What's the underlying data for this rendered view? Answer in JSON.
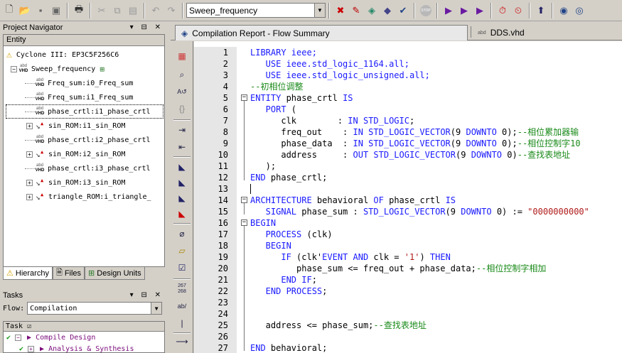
{
  "toolbar": {
    "project_combo_value": "Sweep_frequency",
    "icons": [
      "new-file-icon",
      "open-folder-icon",
      "save-icon",
      "save-all-icon",
      "print-icon",
      "cut-icon",
      "copy-icon",
      "paste-icon",
      "undo-icon",
      "redo-icon",
      "chip-planner-icon",
      "pencil-icon",
      "analysis-icon",
      "assignment-icon",
      "settings-icon",
      "stop-icon",
      "compile-icon",
      "analyze-icon",
      "synthesis-icon",
      "timing-icon",
      "timer-icon",
      "program-icon",
      "rtl-viewer-icon",
      "netlist-icon"
    ]
  },
  "navigator": {
    "title": "Project Navigator",
    "header": "Entity",
    "device": "Cyclone III: EP3C5F256C6",
    "top": "Sweep_frequency",
    "items": [
      {
        "label": "Freq_sum:i0_Freq_sum",
        "kind": "vhd",
        "expand": false
      },
      {
        "label": "Freq_sum:i1_Freq_sum",
        "kind": "vhd",
        "expand": false
      },
      {
        "label": "phase_crtl:i1_phase_crtl",
        "kind": "vhd",
        "expand": false,
        "selected": true
      },
      {
        "label": "sin_ROM:i1_sin_ROM",
        "kind": "rom",
        "expand": true
      },
      {
        "label": "phase_crtl:i2_phase_crtl",
        "kind": "vhd",
        "expand": false
      },
      {
        "label": "sin_ROM:i2_sin_ROM",
        "kind": "rom",
        "expand": true
      },
      {
        "label": "phase_crtl:i3_phase_crtl",
        "kind": "vhd",
        "expand": false
      },
      {
        "label": "sin_ROM:i3_sin_ROM",
        "kind": "rom",
        "expand": true
      },
      {
        "label": "triangle_ROM:i_triangle_",
        "kind": "rom",
        "expand": true
      }
    ],
    "tabs": [
      "Hierarchy",
      "Files",
      "Design Units"
    ]
  },
  "tasks": {
    "title": "Tasks",
    "flow_label": "Flow:",
    "flow_value": "Compilation",
    "header": "Task",
    "rows": [
      "Compile Design",
      "Analysis & Synthesis"
    ]
  },
  "doc_tabs": {
    "report": "Compilation Report - Flow Summary",
    "file": "DDS.vhd"
  },
  "code": {
    "lines": [
      {
        "n": "1",
        "segs": [
          [
            "kw",
            "LIBRARY ieee;"
          ]
        ]
      },
      {
        "n": "2",
        "segs": [
          [
            "kw",
            "   USE ieee.std_logic_1164.all;"
          ]
        ]
      },
      {
        "n": "3",
        "segs": [
          [
            "kw",
            "   USE ieee.std_logic_unsigned.all;"
          ]
        ]
      },
      {
        "n": "4",
        "segs": [
          [
            "cm",
            "--初相位调整"
          ]
        ]
      },
      {
        "n": "5",
        "segs": [
          [
            "kw",
            "ENTITY "
          ],
          [
            "",
            "phase_crtl "
          ],
          [
            "kw",
            "IS"
          ]
        ]
      },
      {
        "n": "6",
        "segs": [
          [
            "kw",
            "   PORT "
          ],
          [
            "",
            "("
          ]
        ]
      },
      {
        "n": "7",
        "segs": [
          [
            "",
            "      clk        : "
          ],
          [
            "kw",
            "IN STD_LOGIC"
          ],
          [
            "",
            ";"
          ]
        ]
      },
      {
        "n": "8",
        "segs": [
          [
            "",
            "      freq_out    : "
          ],
          [
            "kw",
            "IN STD_LOGIC_VECTOR"
          ],
          [
            "",
            "(9 "
          ],
          [
            "kw",
            "DOWNTO "
          ],
          [
            "",
            "0);"
          ],
          [
            "cm",
            "--相位累加器输"
          ]
        ]
      },
      {
        "n": "9",
        "segs": [
          [
            "",
            "      phase_data  : "
          ],
          [
            "kw",
            "IN STD_LOGIC_VECTOR"
          ],
          [
            "",
            "(9 "
          ],
          [
            "kw",
            "DOWNTO "
          ],
          [
            "",
            "0);"
          ],
          [
            "cm",
            "--相位控制字10"
          ]
        ]
      },
      {
        "n": "10",
        "segs": [
          [
            "",
            "      address     : "
          ],
          [
            "kw",
            "OUT STD_LOGIC_VECTOR"
          ],
          [
            "",
            "(9 "
          ],
          [
            "kw",
            "DOWNTO "
          ],
          [
            "",
            "0)"
          ],
          [
            "cm",
            "--查找表地址"
          ]
        ]
      },
      {
        "n": "11",
        "segs": [
          [
            "",
            "   );"
          ]
        ]
      },
      {
        "n": "12",
        "segs": [
          [
            "kw",
            "END "
          ],
          [
            "",
            "phase_crtl;"
          ]
        ]
      },
      {
        "n": "13",
        "segs": [
          [
            "",
            ""
          ]
        ]
      },
      {
        "n": "14",
        "segs": [
          [
            "kw",
            "ARCHITECTURE "
          ],
          [
            "",
            "behavioral "
          ],
          [
            "kw",
            "OF "
          ],
          [
            "",
            "phase_crtl "
          ],
          [
            "kw",
            "IS"
          ]
        ]
      },
      {
        "n": "15",
        "segs": [
          [
            "kw",
            "   SIGNAL "
          ],
          [
            "",
            "phase_sum : "
          ],
          [
            "kw",
            "STD_LOGIC_VECTOR"
          ],
          [
            "",
            "(9 "
          ],
          [
            "kw",
            "DOWNTO "
          ],
          [
            "",
            "0) := "
          ],
          [
            "st",
            "\"0000000000\""
          ]
        ]
      },
      {
        "n": "16",
        "segs": [
          [
            "kw",
            "BEGIN"
          ]
        ]
      },
      {
        "n": "17",
        "segs": [
          [
            "kw",
            "   PROCESS "
          ],
          [
            "",
            "(clk)"
          ]
        ]
      },
      {
        "n": "18",
        "segs": [
          [
            "kw",
            "   BEGIN"
          ]
        ]
      },
      {
        "n": "19",
        "segs": [
          [
            "kw",
            "      IF "
          ],
          [
            "",
            "(clk'"
          ],
          [
            "kw",
            "EVENT AND "
          ],
          [
            "",
            "clk = "
          ],
          [
            "st",
            "'1'"
          ],
          [
            "",
            ") "
          ],
          [
            "kw",
            "THEN"
          ]
        ]
      },
      {
        "n": "20",
        "segs": [
          [
            "",
            "         phase_sum <= freq_out + phase_data;"
          ],
          [
            "cm",
            "--相位控制字相加"
          ]
        ]
      },
      {
        "n": "21",
        "segs": [
          [
            "kw",
            "      END IF"
          ],
          [
            "",
            ";"
          ]
        ]
      },
      {
        "n": "22",
        "segs": [
          [
            "kw",
            "   END PROCESS"
          ],
          [
            "",
            ";"
          ]
        ]
      },
      {
        "n": "23",
        "segs": [
          [
            "",
            ""
          ]
        ]
      },
      {
        "n": "24",
        "segs": [
          [
            "",
            ""
          ]
        ]
      },
      {
        "n": "25",
        "segs": [
          [
            "",
            "   address <= phase_sum;"
          ],
          [
            "cm",
            "--查找表地址"
          ]
        ]
      },
      {
        "n": "26",
        "segs": [
          [
            "",
            ""
          ]
        ]
      },
      {
        "n": "27",
        "segs": [
          [
            "kw",
            "END "
          ],
          [
            "",
            "behavioral;"
          ]
        ]
      }
    ]
  },
  "colors": {
    "keyword": "#1a1aff",
    "comment": "#1a8a1a",
    "string": "#b01a1a"
  }
}
